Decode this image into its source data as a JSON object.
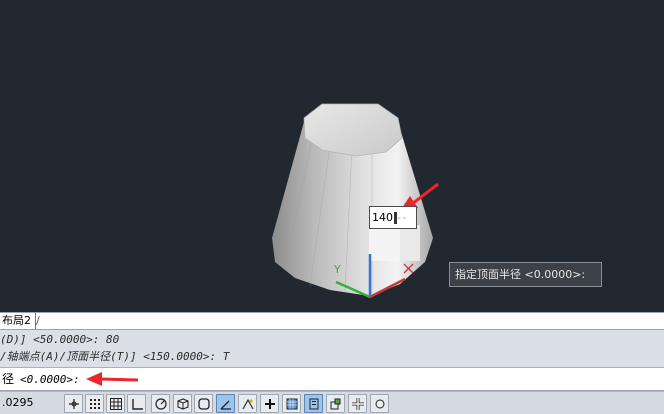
{
  "viewport": {
    "dynamic_input_value": "140",
    "tooltip_text": "指定顶面半径 <0.0000>:",
    "ucs_y_label": "Y"
  },
  "tabs": {
    "active_label": "布局2",
    "separator": "/"
  },
  "command_history": {
    "line1": "(D)] <50.0000>: 80",
    "line2": "/轴端点(A)/顶面半径(T)] <150.0000>: T"
  },
  "command_line": {
    "label": "径",
    "prompt": "<0.0000>:"
  },
  "status_bar": {
    "coordinate": ".0295",
    "buttons": [
      {
        "icon": "infer-constraints-icon",
        "on": false
      },
      {
        "icon": "snap-mode-icon",
        "on": false
      },
      {
        "icon": "grid-display-icon",
        "on": false
      },
      {
        "icon": "ortho-mode-icon",
        "on": false
      },
      {
        "icon": "polar-tracking-icon",
        "on": false
      },
      {
        "icon": "3d-object-snap-icon",
        "on": false
      },
      {
        "icon": "object-snap-icon",
        "on": false
      },
      {
        "icon": "allow-dynamic-ucs-icon",
        "on": true
      },
      {
        "icon": "object-snap-tracking-icon",
        "on": false
      },
      {
        "icon": "dynamic-input-icon",
        "on": false
      },
      {
        "icon": "lineweight-icon",
        "on": false
      },
      {
        "icon": "transparency-icon",
        "on": true
      },
      {
        "icon": "quick-properties-icon",
        "on": false
      },
      {
        "icon": "selection-cycling-icon",
        "on": false
      },
      {
        "icon": "annotation-monitor-icon",
        "on": false
      }
    ]
  },
  "colors": {
    "viewport_bg": "#212830",
    "arrow": "#e8262b",
    "ucs_x": "#c83a3a",
    "ucs_y": "#33b233",
    "ucs_z": "#3a6fd8"
  }
}
